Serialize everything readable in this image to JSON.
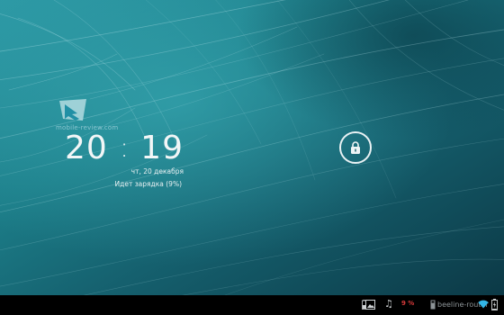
{
  "watermark": {
    "text": "mobile-review.com"
  },
  "clock": {
    "hours": "20",
    "colon": ":",
    "minutes": "19"
  },
  "date": "чт, 20 декабря",
  "charging": "Идет зарядка (9%)",
  "status_bar": {
    "cpu_text": "9 %",
    "wifi_name": "beeline-router"
  },
  "colors": {
    "wallpaper_primary": "#1f7c86",
    "statusbar": "#000000",
    "cpu_red": "#d83a3a",
    "wifi_cyan": "#33b5e5"
  }
}
